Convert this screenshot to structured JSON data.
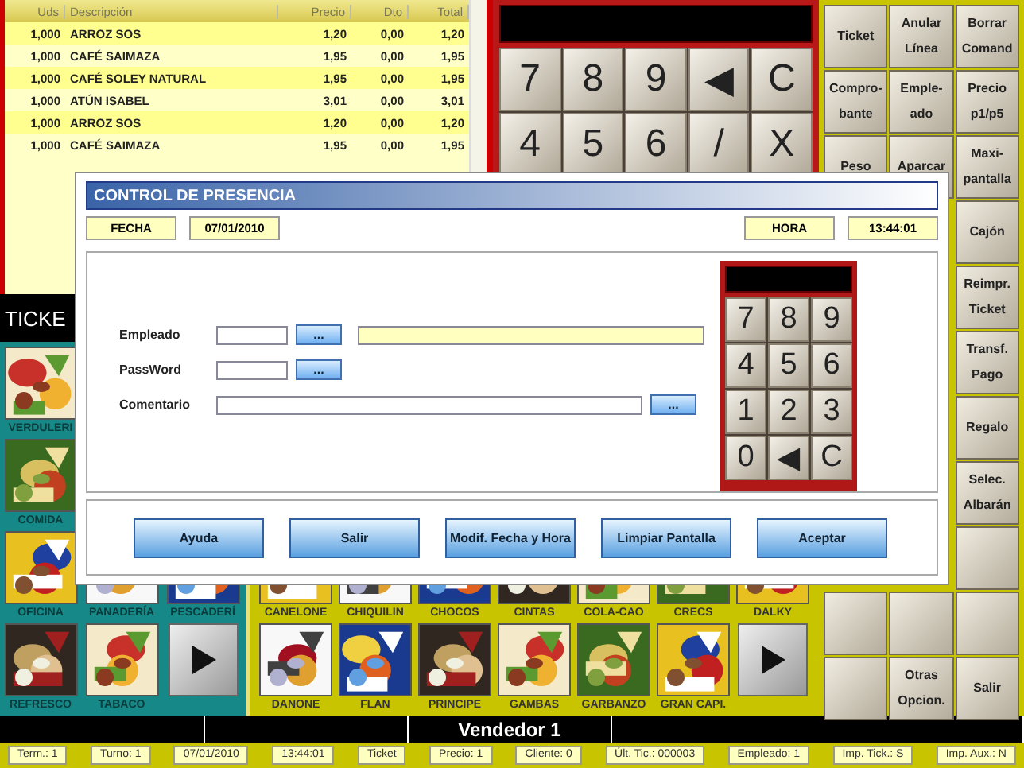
{
  "ticket": {
    "columns": [
      "Uds",
      "Descripción",
      "Precio",
      "Dto",
      "Total"
    ],
    "rows": [
      [
        "1,000",
        "ARROZ SOS",
        "1,20",
        "0,00",
        "1,20"
      ],
      [
        "1,000",
        "CAFÉ SAIMAZA",
        "1,95",
        "0,00",
        "1,95"
      ],
      [
        "1,000",
        "CAFÉ SOLEY NATURAL",
        "1,95",
        "0,00",
        "1,95"
      ],
      [
        "1,000",
        "ATÚN ISABEL",
        "3,01",
        "0,00",
        "3,01"
      ],
      [
        "1,000",
        "ARROZ SOS",
        "1,20",
        "0,00",
        "1,20"
      ],
      [
        "1,000",
        "CAFÉ SAIMAZA",
        "1,95",
        "0,00",
        "1,95"
      ]
    ],
    "label": "TICKE"
  },
  "keypad": {
    "keys": [
      "7",
      "8",
      "9",
      "◀",
      "C",
      "4",
      "5",
      "6",
      "/",
      "X"
    ]
  },
  "function_buttons": {
    "rows": [
      [
        {
          "kind": "label",
          "lines": [
            "Ticket"
          ]
        },
        {
          "kind": "label",
          "lines": [
            "Anular",
            "Línea"
          ]
        },
        {
          "kind": "label",
          "lines": [
            "Borrar",
            "Comand"
          ]
        }
      ],
      [
        {
          "kind": "label",
          "lines": [
            "Compro-",
            "bante"
          ]
        },
        {
          "kind": "label",
          "lines": [
            "Emple-",
            "ado"
          ]
        },
        {
          "kind": "label",
          "lines": [
            "Precio",
            "p1/p5"
          ]
        }
      ],
      [
        {
          "kind": "label",
          "lines": [
            "Peso"
          ]
        },
        {
          "kind": "label",
          "lines": [
            "Aparcar"
          ]
        },
        {
          "kind": "label",
          "lines": [
            "Maxi-",
            "pantalla"
          ]
        }
      ],
      [
        {
          "kind": "label",
          "lines": [
            "Cajón"
          ]
        }
      ],
      [
        {
          "kind": "label",
          "lines": [
            "Reimpr.",
            "Ticket"
          ]
        }
      ],
      [
        {
          "kind": "label",
          "lines": [
            "Transf.",
            "Pago"
          ]
        }
      ],
      [
        {
          "kind": "label",
          "lines": [
            "Regalo"
          ]
        }
      ],
      [
        {
          "kind": "label",
          "lines": [
            "Selec.",
            "Albarán"
          ]
        }
      ],
      [
        {
          "kind": "blank"
        }
      ],
      [
        {
          "kind": "blank"
        },
        {
          "kind": "blank"
        },
        {
          "kind": "blank"
        }
      ],
      [
        {
          "kind": "blank"
        },
        {
          "kind": "label",
          "lines": [
            "Otras",
            "Opcion."
          ]
        },
        {
          "kind": "label",
          "lines": [
            "Salir"
          ]
        }
      ]
    ]
  },
  "categories": {
    "rows": [
      [
        {
          "kind": "picture",
          "label": "VERDULERI"
        }
      ],
      [
        {
          "kind": "picture",
          "label": "COMIDA"
        }
      ],
      [
        {
          "kind": "picture",
          "label": "OFICINA"
        },
        {
          "kind": "picture",
          "label": "PANADERÍA"
        },
        {
          "kind": "picture",
          "label": "PESCADERÍ"
        }
      ],
      [
        {
          "kind": "picture",
          "label": "REFRESCO"
        },
        {
          "kind": "picture",
          "label": "TABACO"
        },
        {
          "kind": "next"
        }
      ]
    ]
  },
  "products": {
    "rows": [
      [
        {
          "kind": "picture",
          "label": "CANELONE"
        },
        {
          "kind": "picture",
          "label": "CHIQUILIN"
        },
        {
          "kind": "picture",
          "label": "CHOCOS"
        },
        {
          "kind": "picture",
          "label": "CINTAS"
        },
        {
          "kind": "picture",
          "label": "COLA-CAO"
        },
        {
          "kind": "picture",
          "label": "CRECS"
        },
        {
          "kind": "picture",
          "label": "DALKY"
        }
      ],
      [
        {
          "kind": "picture",
          "label": "DANONE"
        },
        {
          "kind": "picture",
          "label": "FLAN"
        },
        {
          "kind": "picture",
          "label": "PRINCIPE"
        },
        {
          "kind": "picture",
          "label": "GAMBAS"
        },
        {
          "kind": "picture",
          "label": "GARBANZO"
        },
        {
          "kind": "picture",
          "label": "GRAN CAPI."
        },
        {
          "kind": "next"
        }
      ]
    ]
  },
  "seller": "Vendedor 1",
  "status_bar": [
    "Term.: 1",
    "Turno: 1",
    "07/01/2010",
    "13:44:01",
    "Ticket",
    "Precio: 1",
    "Cliente: 0",
    "Últ. Tic.: 000003",
    "Empleado: 1",
    "Imp. Tick.: S",
    "Imp. Aux.: N"
  ],
  "dialog": {
    "title": "CONTROL DE PRESENCIA",
    "date_label": "FECHA",
    "date": "07/01/2010",
    "time_label": "HORA",
    "time": "13:44:01",
    "fields": [
      {
        "kind": "lookup",
        "label": "Empleado",
        "button": "..."
      },
      {
        "kind": "short",
        "label": "PassWord",
        "button": "..."
      },
      {
        "kind": "long",
        "label": "Comentario",
        "button": "..."
      }
    ],
    "keypad": [
      "7",
      "8",
      "9",
      "4",
      "5",
      "6",
      "1",
      "2",
      "3",
      "0",
      "◀",
      "C"
    ],
    "buttons": [
      "Ayuda",
      "Salir",
      "Modif. Fecha y Hora",
      "Limpiar Pantalla",
      "Aceptar"
    ]
  }
}
